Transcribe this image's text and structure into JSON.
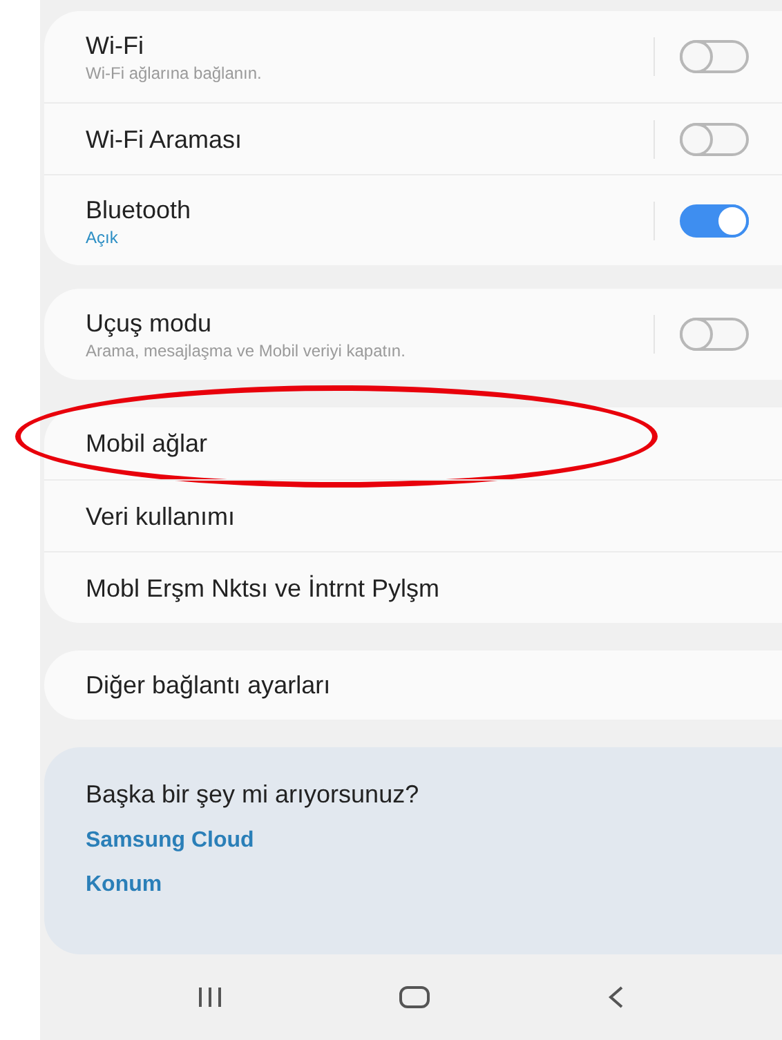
{
  "cards": [
    {
      "items": [
        {
          "title": "Wi-Fi",
          "subtitle": "Wi-Fi ağlarına bağlanın.",
          "subtitle_accent": false,
          "toggle": {
            "on": false
          }
        },
        {
          "title": "Wi-Fi Araması",
          "toggle": {
            "on": false
          }
        },
        {
          "title": "Bluetooth",
          "subtitle": "Açık",
          "subtitle_accent": true,
          "toggle": {
            "on": true
          }
        }
      ]
    },
    {
      "items": [
        {
          "title": "Uçuş modu",
          "subtitle": "Arama, mesajlaşma ve Mobil veriyi kapatın.",
          "subtitle_accent": false,
          "toggle": {
            "on": false
          }
        }
      ]
    },
    {
      "items": [
        {
          "title": "Mobil ağlar",
          "highlighted": true
        },
        {
          "title": "Veri kullanımı",
          "highlighted": false
        },
        {
          "title": "Mobl Erşm Nktsı ve İntrnt Pylşm",
          "highlighted": false
        }
      ]
    },
    {
      "items": [
        {
          "title": "Diğer bağlantı ayarları",
          "highlighted": false
        }
      ]
    }
  ],
  "suggestions": {
    "title": "Başka bir şey mi arıyorsunuz?",
    "links": [
      "Samsung Cloud",
      "Konum"
    ]
  }
}
